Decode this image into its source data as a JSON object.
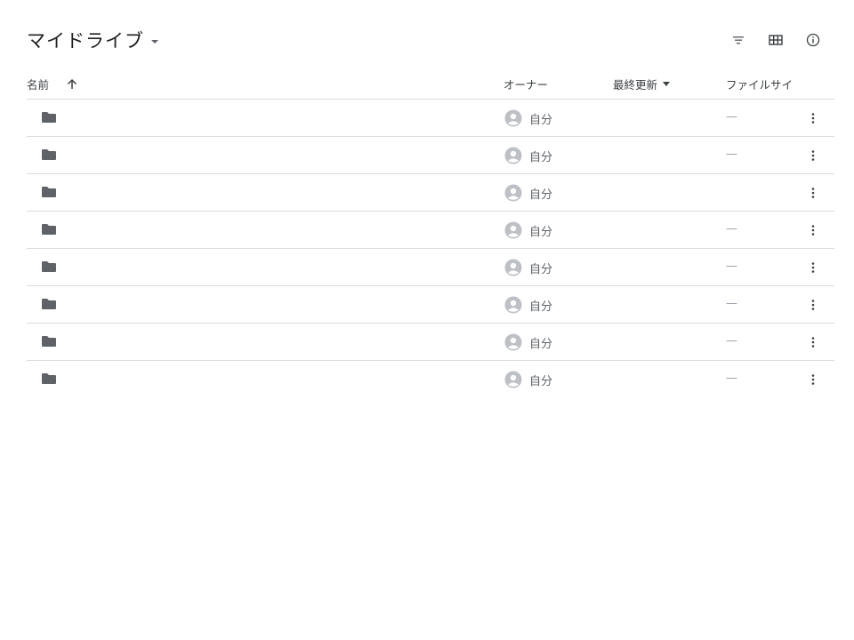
{
  "header": {
    "title": "マイドライブ",
    "tools": [
      {
        "icon": "filter-icon"
      },
      {
        "icon": "grid-view-icon"
      },
      {
        "icon": "info-icon"
      }
    ]
  },
  "columns": {
    "name": "名前",
    "owner": "オーナー",
    "modified": "最終更新",
    "size": "ファイルサイ"
  },
  "rows": [
    {
      "owner": "自分",
      "size": "—"
    },
    {
      "owner": "自分",
      "size": "—"
    },
    {
      "owner": "自分",
      "size": ""
    },
    {
      "owner": "自分",
      "size": "—"
    },
    {
      "owner": "自分",
      "size": "—"
    },
    {
      "owner": "自分",
      "size": "—"
    },
    {
      "owner": "自分",
      "size": "—"
    },
    {
      "owner": "自分",
      "size": "—"
    }
  ],
  "colors": {
    "icon": "#5f6368",
    "divider": "#dadce0",
    "avatar": "#bdc1c6"
  }
}
